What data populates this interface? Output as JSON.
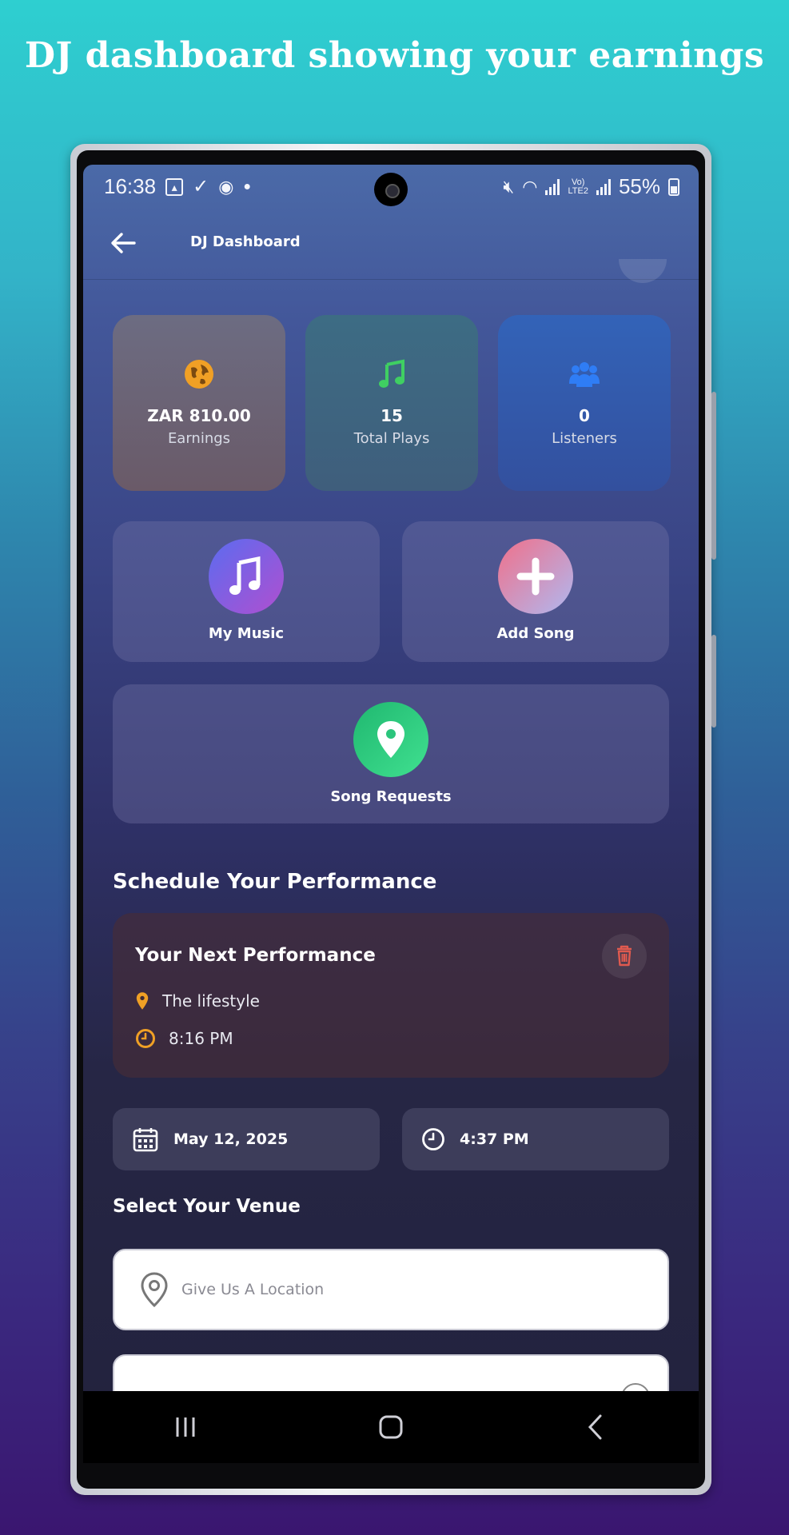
{
  "headline": "DJ dashboard showing your earnings",
  "status_bar": {
    "time": "16:38",
    "battery": "55%"
  },
  "app_bar": {
    "title": "DJ Dashboard"
  },
  "stats": [
    {
      "value": "ZAR 810.00",
      "label": "Earnings",
      "color": "#f0a025"
    },
    {
      "value": "15",
      "label": "Total Plays",
      "color": "#3fcf62"
    },
    {
      "value": "0",
      "label": "Listeners",
      "color": "#2f7df5"
    }
  ],
  "tiles": {
    "my_music": "My Music",
    "add_song": "Add Song",
    "song_requests": "Song Requests"
  },
  "schedule": {
    "section_title": "Schedule Your Performance",
    "next_title": "Your Next Performance",
    "venue": "The lifestyle",
    "time": "8:16 PM",
    "date_picker": "May 12, 2025",
    "time_picker": "4:37 PM"
  },
  "venue_section": {
    "title": "Select Your Venue",
    "location_placeholder": "Give Us A Location"
  },
  "colors": {
    "accent_orange": "#f0a025",
    "trash_red": "#e05a4f"
  }
}
